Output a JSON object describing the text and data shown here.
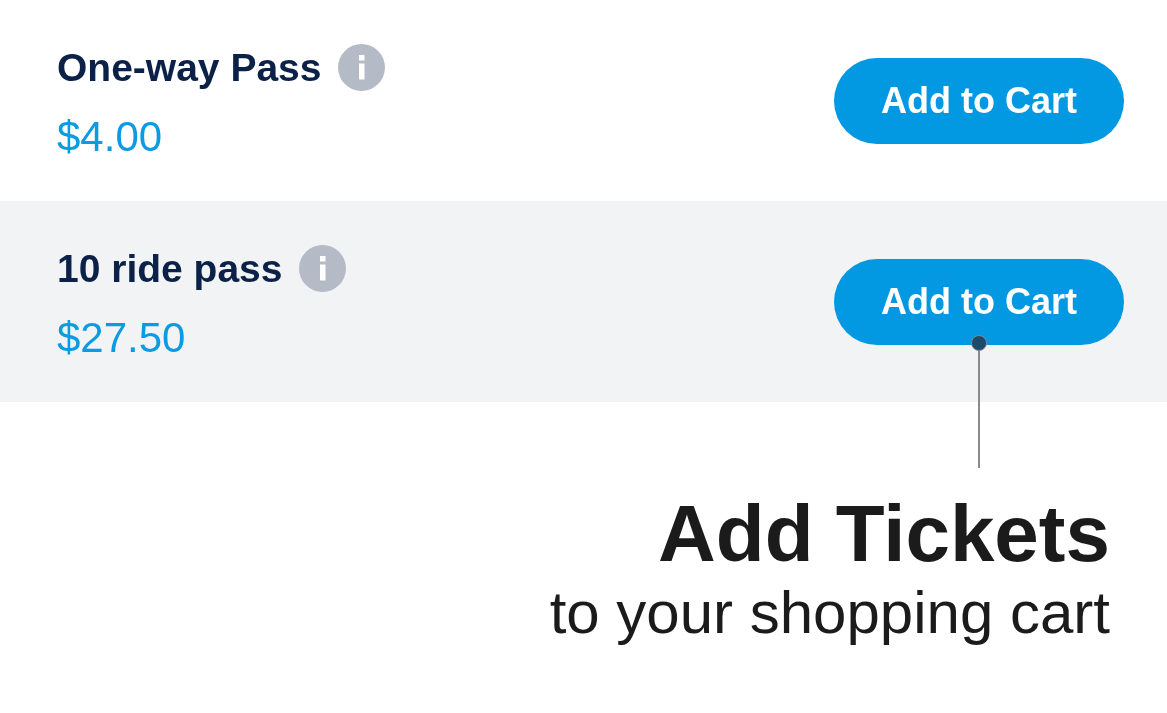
{
  "rows": [
    {
      "name": "One-way Pass",
      "price": "$4.00",
      "button": "Add to Cart",
      "annotated": false
    },
    {
      "name": "10 ride pass",
      "price": "$27.50",
      "button": "Add to Cart",
      "annotated": true
    }
  ],
  "callout": {
    "title": "Add Tickets",
    "subtitle": "to your shopping cart"
  }
}
